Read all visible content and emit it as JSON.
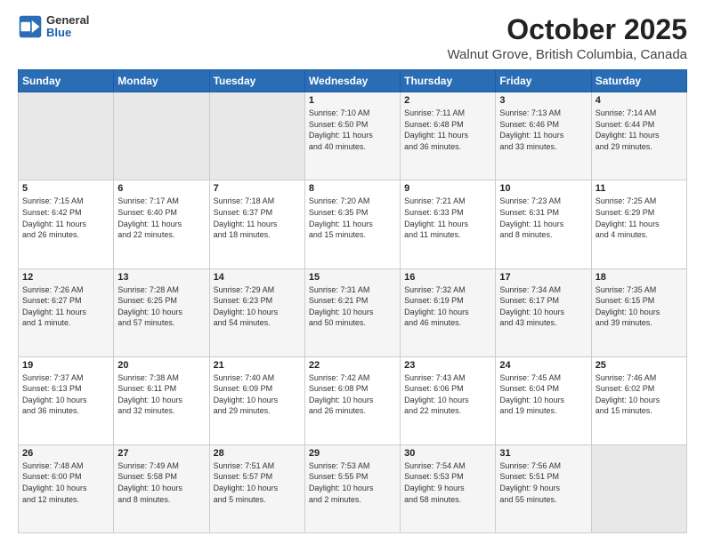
{
  "header": {
    "logo_line1": "General",
    "logo_line2": "Blue",
    "month": "October 2025",
    "location": "Walnut Grove, British Columbia, Canada"
  },
  "days_of_week": [
    "Sunday",
    "Monday",
    "Tuesday",
    "Wednesday",
    "Thursday",
    "Friday",
    "Saturday"
  ],
  "weeks": [
    [
      {
        "day": "",
        "info": ""
      },
      {
        "day": "",
        "info": ""
      },
      {
        "day": "",
        "info": ""
      },
      {
        "day": "1",
        "info": "Sunrise: 7:10 AM\nSunset: 6:50 PM\nDaylight: 11 hours\nand 40 minutes."
      },
      {
        "day": "2",
        "info": "Sunrise: 7:11 AM\nSunset: 6:48 PM\nDaylight: 11 hours\nand 36 minutes."
      },
      {
        "day": "3",
        "info": "Sunrise: 7:13 AM\nSunset: 6:46 PM\nDaylight: 11 hours\nand 33 minutes."
      },
      {
        "day": "4",
        "info": "Sunrise: 7:14 AM\nSunset: 6:44 PM\nDaylight: 11 hours\nand 29 minutes."
      }
    ],
    [
      {
        "day": "5",
        "info": "Sunrise: 7:15 AM\nSunset: 6:42 PM\nDaylight: 11 hours\nand 26 minutes."
      },
      {
        "day": "6",
        "info": "Sunrise: 7:17 AM\nSunset: 6:40 PM\nDaylight: 11 hours\nand 22 minutes."
      },
      {
        "day": "7",
        "info": "Sunrise: 7:18 AM\nSunset: 6:37 PM\nDaylight: 11 hours\nand 18 minutes."
      },
      {
        "day": "8",
        "info": "Sunrise: 7:20 AM\nSunset: 6:35 PM\nDaylight: 11 hours\nand 15 minutes."
      },
      {
        "day": "9",
        "info": "Sunrise: 7:21 AM\nSunset: 6:33 PM\nDaylight: 11 hours\nand 11 minutes."
      },
      {
        "day": "10",
        "info": "Sunrise: 7:23 AM\nSunset: 6:31 PM\nDaylight: 11 hours\nand 8 minutes."
      },
      {
        "day": "11",
        "info": "Sunrise: 7:25 AM\nSunset: 6:29 PM\nDaylight: 11 hours\nand 4 minutes."
      }
    ],
    [
      {
        "day": "12",
        "info": "Sunrise: 7:26 AM\nSunset: 6:27 PM\nDaylight: 11 hours\nand 1 minute."
      },
      {
        "day": "13",
        "info": "Sunrise: 7:28 AM\nSunset: 6:25 PM\nDaylight: 10 hours\nand 57 minutes."
      },
      {
        "day": "14",
        "info": "Sunrise: 7:29 AM\nSunset: 6:23 PM\nDaylight: 10 hours\nand 54 minutes."
      },
      {
        "day": "15",
        "info": "Sunrise: 7:31 AM\nSunset: 6:21 PM\nDaylight: 10 hours\nand 50 minutes."
      },
      {
        "day": "16",
        "info": "Sunrise: 7:32 AM\nSunset: 6:19 PM\nDaylight: 10 hours\nand 46 minutes."
      },
      {
        "day": "17",
        "info": "Sunrise: 7:34 AM\nSunset: 6:17 PM\nDaylight: 10 hours\nand 43 minutes."
      },
      {
        "day": "18",
        "info": "Sunrise: 7:35 AM\nSunset: 6:15 PM\nDaylight: 10 hours\nand 39 minutes."
      }
    ],
    [
      {
        "day": "19",
        "info": "Sunrise: 7:37 AM\nSunset: 6:13 PM\nDaylight: 10 hours\nand 36 minutes."
      },
      {
        "day": "20",
        "info": "Sunrise: 7:38 AM\nSunset: 6:11 PM\nDaylight: 10 hours\nand 32 minutes."
      },
      {
        "day": "21",
        "info": "Sunrise: 7:40 AM\nSunset: 6:09 PM\nDaylight: 10 hours\nand 29 minutes."
      },
      {
        "day": "22",
        "info": "Sunrise: 7:42 AM\nSunset: 6:08 PM\nDaylight: 10 hours\nand 26 minutes."
      },
      {
        "day": "23",
        "info": "Sunrise: 7:43 AM\nSunset: 6:06 PM\nDaylight: 10 hours\nand 22 minutes."
      },
      {
        "day": "24",
        "info": "Sunrise: 7:45 AM\nSunset: 6:04 PM\nDaylight: 10 hours\nand 19 minutes."
      },
      {
        "day": "25",
        "info": "Sunrise: 7:46 AM\nSunset: 6:02 PM\nDaylight: 10 hours\nand 15 minutes."
      }
    ],
    [
      {
        "day": "26",
        "info": "Sunrise: 7:48 AM\nSunset: 6:00 PM\nDaylight: 10 hours\nand 12 minutes."
      },
      {
        "day": "27",
        "info": "Sunrise: 7:49 AM\nSunset: 5:58 PM\nDaylight: 10 hours\nand 8 minutes."
      },
      {
        "day": "28",
        "info": "Sunrise: 7:51 AM\nSunset: 5:57 PM\nDaylight: 10 hours\nand 5 minutes."
      },
      {
        "day": "29",
        "info": "Sunrise: 7:53 AM\nSunset: 5:55 PM\nDaylight: 10 hours\nand 2 minutes."
      },
      {
        "day": "30",
        "info": "Sunrise: 7:54 AM\nSunset: 5:53 PM\nDaylight: 9 hours\nand 58 minutes."
      },
      {
        "day": "31",
        "info": "Sunrise: 7:56 AM\nSunset: 5:51 PM\nDaylight: 9 hours\nand 55 minutes."
      },
      {
        "day": "",
        "info": ""
      }
    ]
  ]
}
